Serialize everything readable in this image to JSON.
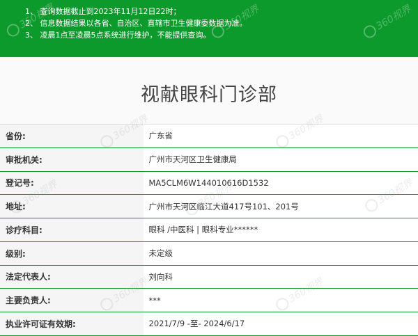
{
  "notice": {
    "lines": [
      "1、 查询数据截止到2023年11月12日22时；",
      "2、 信息数据结果以各省、自治区、直辖市卫生健康委数据为准。",
      "3、 凌晨1点至凌晨5点系统进行维护，不能提供查询。"
    ]
  },
  "page": {
    "title": "视献眼科门诊部"
  },
  "watermark": {
    "text": "360视界"
  },
  "info": {
    "rows": [
      {
        "label": "省份:",
        "value": "广东省"
      },
      {
        "label": "审批机关:",
        "value": "广州市天河区卫生健康局"
      },
      {
        "label": "登记号:",
        "value": "MA5CLM6W144010616D1532"
      },
      {
        "label": "地址:",
        "value": "广州市天河区临江大道417号101、201号"
      },
      {
        "label": "诊疗科目:",
        "value": "眼科 /中医科  |  眼科专业******"
      },
      {
        "label": "级别:",
        "value": "未定级"
      },
      {
        "label": "法定代表人:",
        "value": "刘向科"
      },
      {
        "label": "主要负责人:",
        "value": "***"
      },
      {
        "label": "执业许可证有效期:",
        "value": "2021/7/9 -至- 2024/6/17"
      }
    ]
  },
  "colors": {
    "notice_bg": "#0c9a2c",
    "row_divider": "#0c9a2c",
    "label_bg": "#f5f5f5"
  }
}
